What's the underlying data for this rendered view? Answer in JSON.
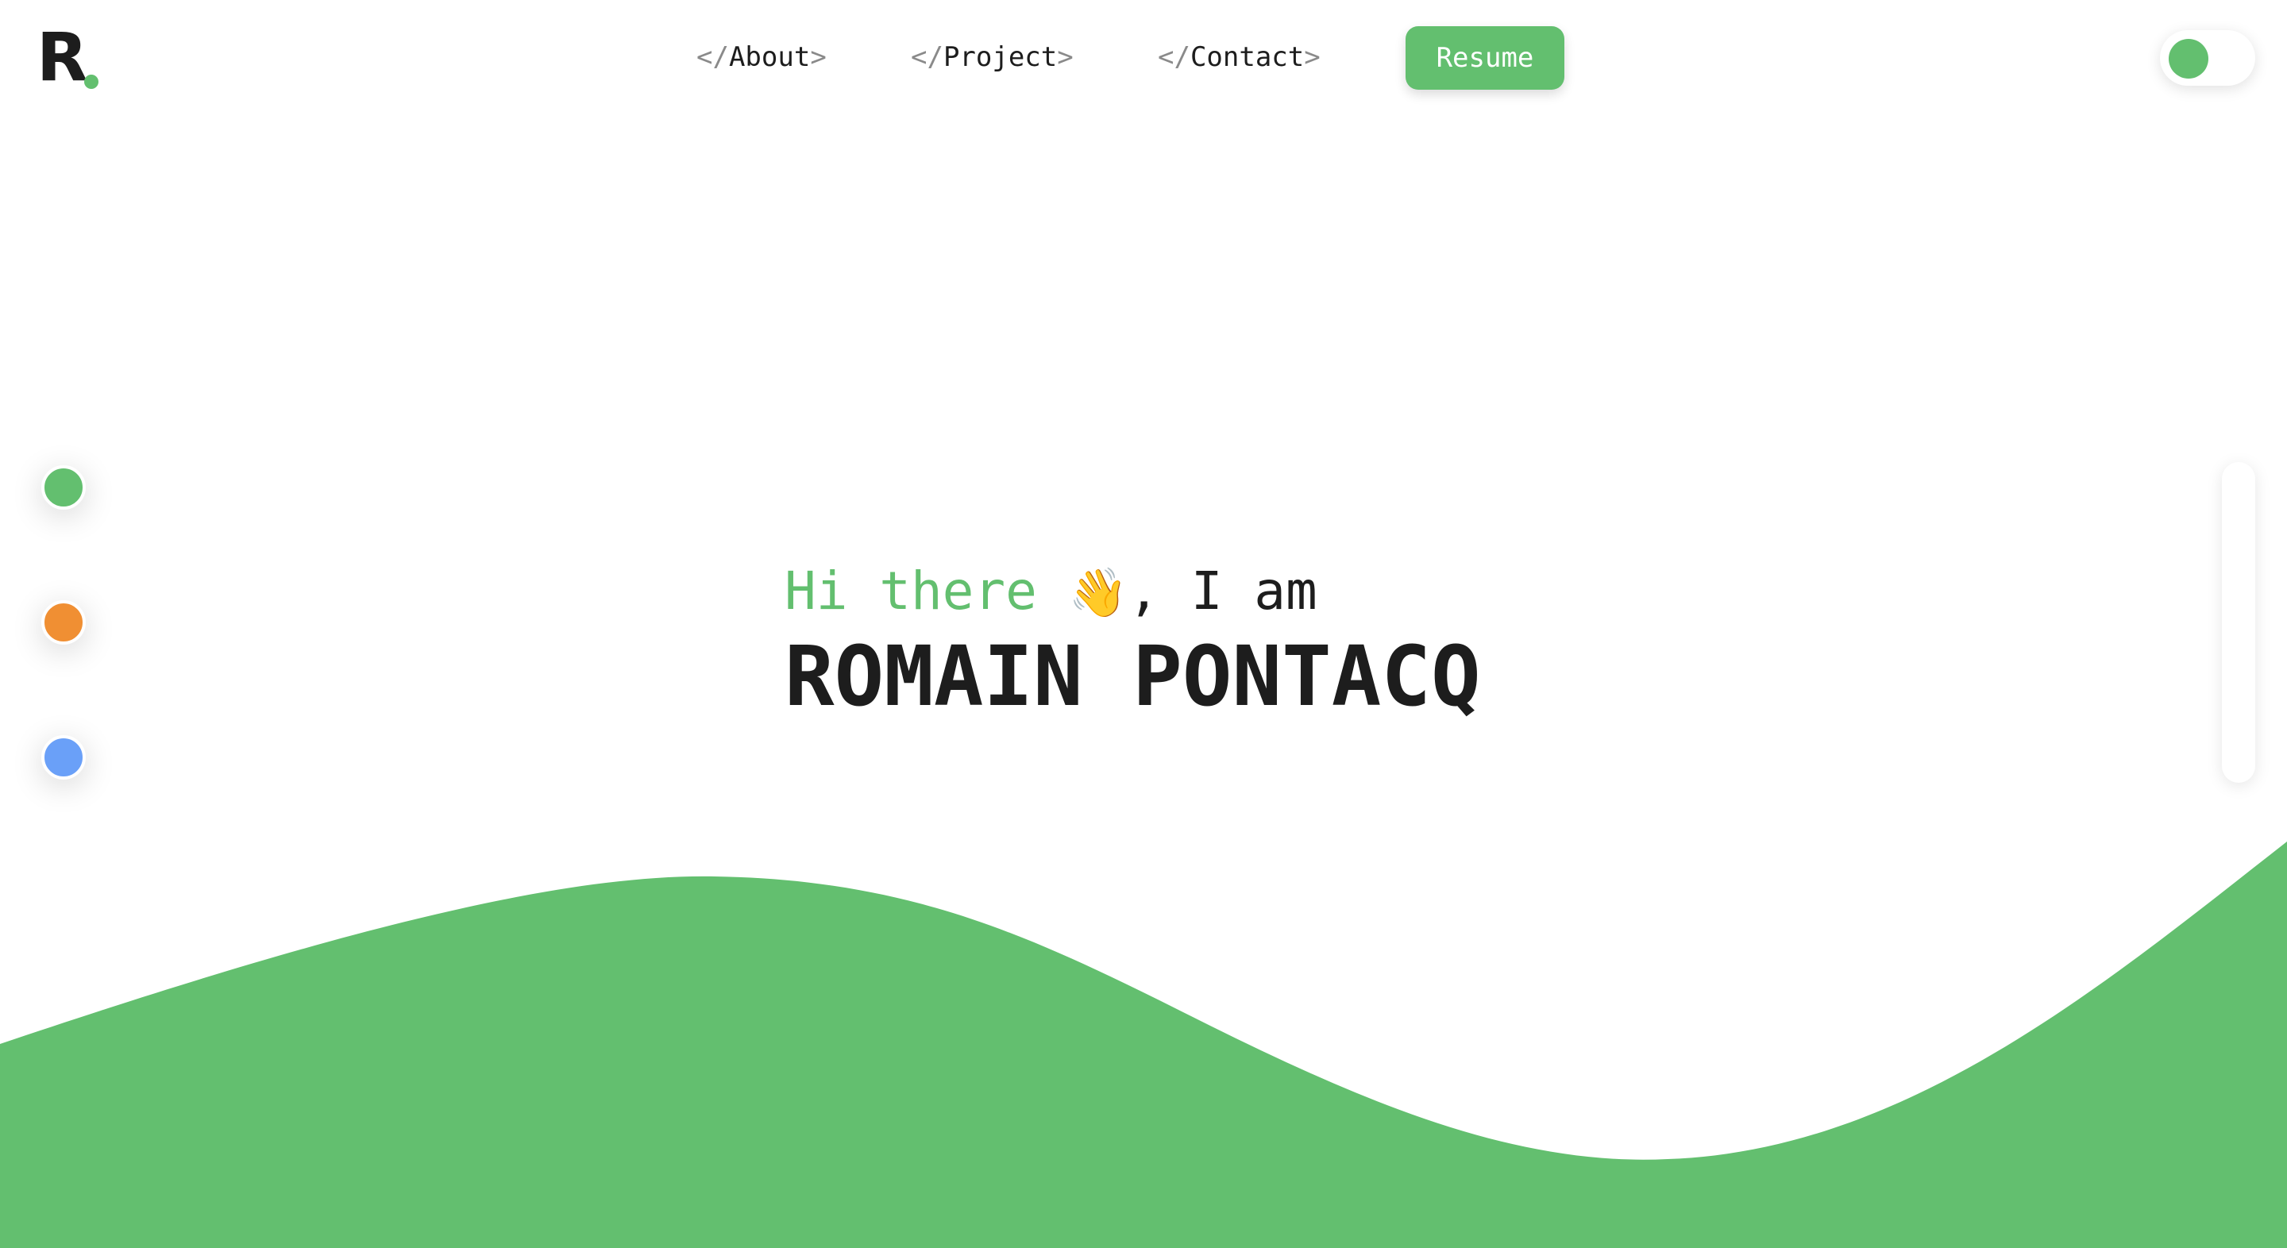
{
  "logo": {
    "letter": "R"
  },
  "nav": {
    "items": [
      {
        "open": "</",
        "label": "About",
        "close": ">"
      },
      {
        "open": "</",
        "label": "Project",
        "close": ">"
      },
      {
        "open": "</",
        "label": "Contact",
        "close": ">"
      }
    ],
    "resume_label": "Resume"
  },
  "theme_toggle": {
    "state": "on"
  },
  "color_options": [
    "#63bf6f",
    "#f08f33",
    "#6aa0f8"
  ],
  "hero": {
    "greeting_green": "Hi there",
    "wave_emoji": "👋",
    "greeting_rest": ", I am",
    "name": "ROMAIN PONTACQ"
  },
  "colors": {
    "accent": "#63bf6f",
    "text": "#1d1d1d",
    "background": "#ffffff"
  }
}
